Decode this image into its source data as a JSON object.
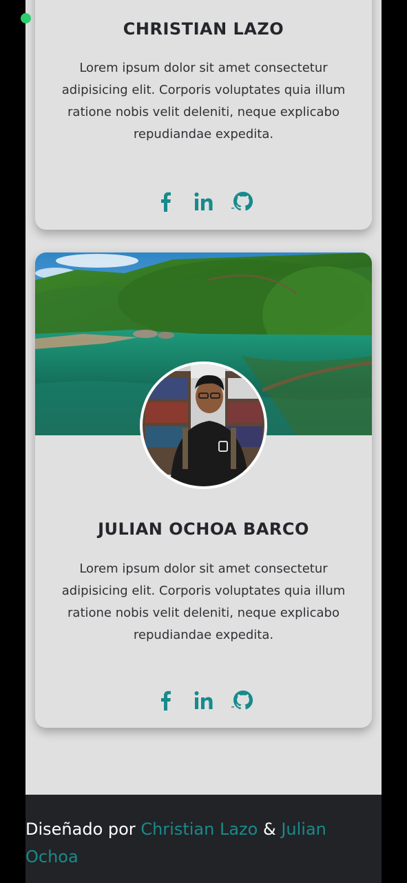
{
  "colors": {
    "accent": "#178a8c",
    "card_bg": "#e0e0e0",
    "footer_bg": "#212327",
    "status_dot": "#2ecc71"
  },
  "cards": [
    {
      "name": "CHRISTIAN LAZO",
      "description": "Lorem ipsum dolor sit amet consectetur adipisicing elit. Corporis voluptates quia illum ratione nobis velit deleniti, neque explicabo repudiandae expedita.",
      "socials": [
        "facebook-icon",
        "linkedin-icon",
        "github-icon"
      ]
    },
    {
      "name": "JULIAN OCHOA BARCO",
      "description": "Lorem ipsum dolor sit amet consectetur adipisicing elit. Corporis voluptates quia illum ratione nobis velit deleniti, neque explicabo repudiandae expedita.",
      "socials": [
        "facebook-icon",
        "linkedin-icon",
        "github-icon"
      ]
    }
  ],
  "footer": {
    "prefix": "Diseñado por",
    "author1": "Christian Lazo",
    "separator": "&",
    "author2": "Julian Ochoa"
  }
}
